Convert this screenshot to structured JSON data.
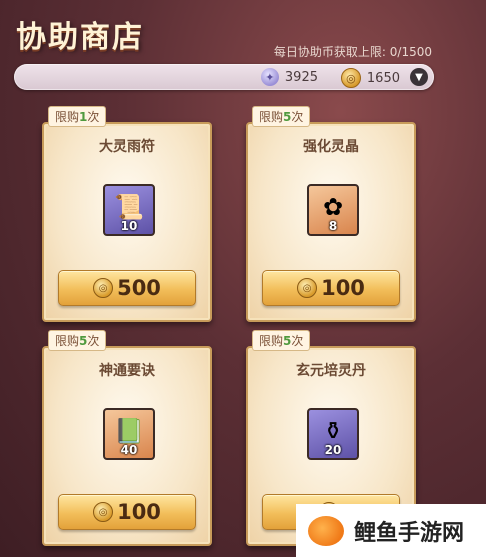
{
  "header": {
    "title": "协助商店",
    "limit_text": "每日协助币获取上限: 0/1500"
  },
  "currency": {
    "spirit_amount": "3925",
    "coin_amount": "1650",
    "spirit_icon": "spirit-coin-icon",
    "gold_icon": "gold-coin-icon"
  },
  "cards": [
    {
      "limit_prefix": "限购",
      "limit_num": "1",
      "limit_suffix": "次",
      "name": "大灵雨符",
      "count": "10",
      "price": "500",
      "icon": "scroll-icon"
    },
    {
      "limit_prefix": "限购",
      "limit_num": "5",
      "limit_suffix": "次",
      "name": "强化灵晶",
      "count": "8",
      "price": "100",
      "icon": "crystal-flower-icon"
    },
    {
      "limit_prefix": "限购",
      "limit_num": "5",
      "limit_suffix": "次",
      "name": "神通要诀",
      "count": "40",
      "price": "100",
      "icon": "jade-book-icon"
    },
    {
      "limit_prefix": "限购",
      "limit_num": "5",
      "limit_suffix": "次",
      "name": "玄元培灵丹",
      "count": "20",
      "price": "",
      "icon": "pill-gourd-icon"
    }
  ],
  "watermark": {
    "text": "鲤鱼手游网"
  }
}
